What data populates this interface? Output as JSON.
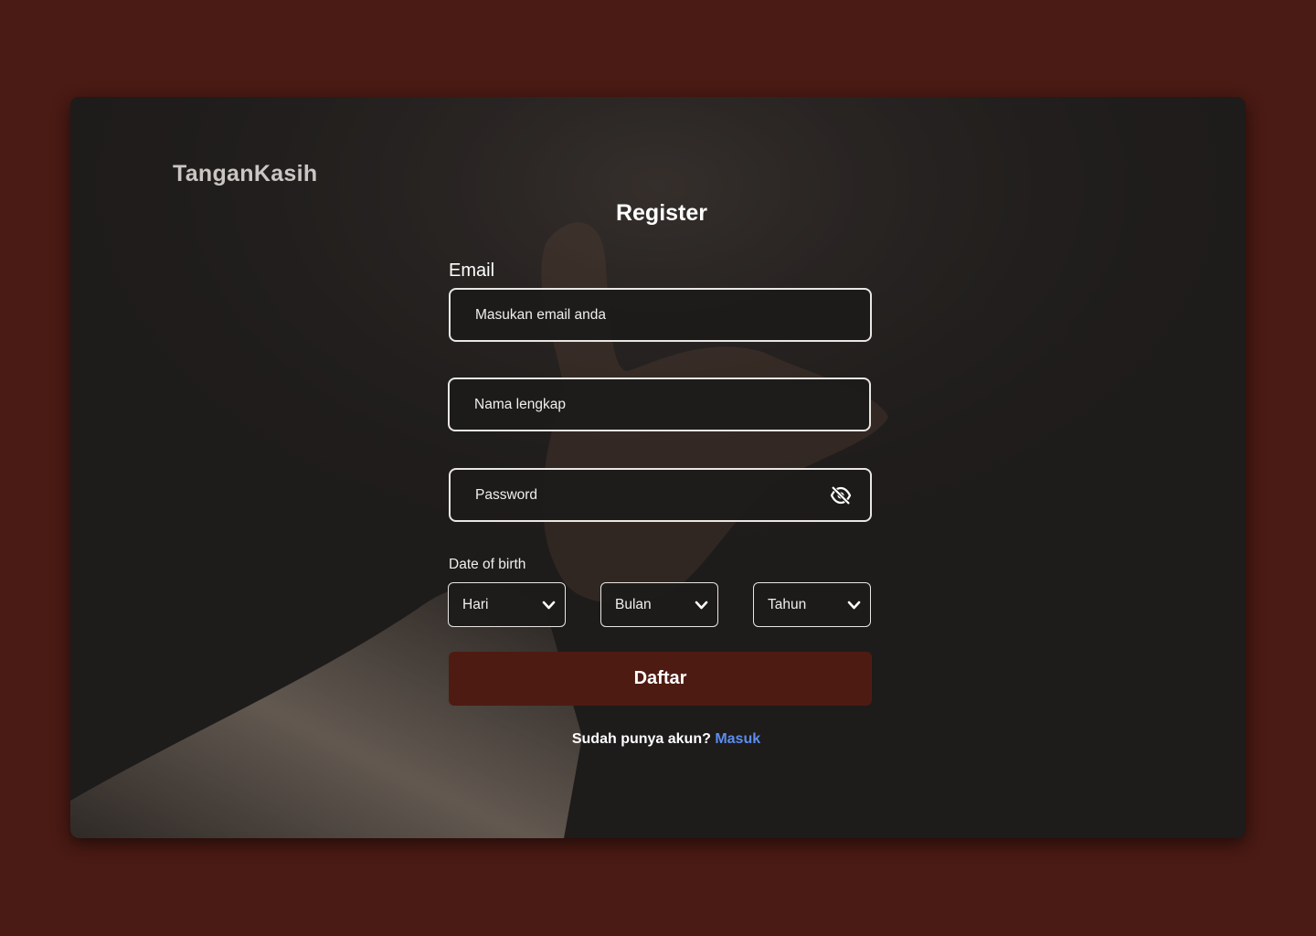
{
  "brand": "TanganKasih",
  "title": "Register",
  "email": {
    "label": "Email",
    "placeholder": "Masukan email anda"
  },
  "fullname": {
    "placeholder": "Nama lengkap"
  },
  "password": {
    "placeholder": "Password",
    "toggle_icon": "eye-off-icon"
  },
  "dob": {
    "label": "Date of birth",
    "day": "Hari",
    "month": "Bulan",
    "year": "Tahun"
  },
  "submit_label": "Daftar",
  "footer": {
    "prompt": "Sudah punya akun?",
    "link": "Masuk"
  },
  "colors": {
    "page_bg": "#4a1a14",
    "button_bg": "#4e1b12",
    "link": "#5b8def"
  }
}
